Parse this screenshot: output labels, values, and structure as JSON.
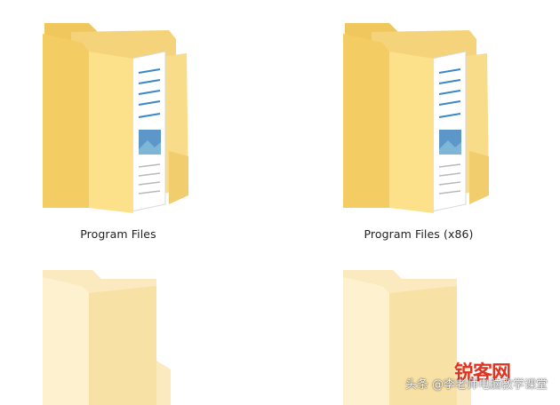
{
  "files": [
    {
      "name": "Program Files",
      "icon": "folder-with-documents-icon"
    },
    {
      "name": "Program Files (x86)",
      "icon": "folder-with-documents-icon"
    },
    {
      "name": "",
      "icon": "empty-folder-icon"
    },
    {
      "name": "",
      "icon": "empty-folder-icon"
    }
  ],
  "watermark": {
    "site_logo": "锐客网",
    "text": "头条 @李老师电脑教学课堂"
  },
  "colors": {
    "folder_back": "#f2cd6e",
    "folder_front": "#fde9a2",
    "folder_light_back": "#f9e3a8",
    "folder_light_front": "#fdf1cf",
    "doc_line": "#3a86c8",
    "background": "#ffffff"
  }
}
